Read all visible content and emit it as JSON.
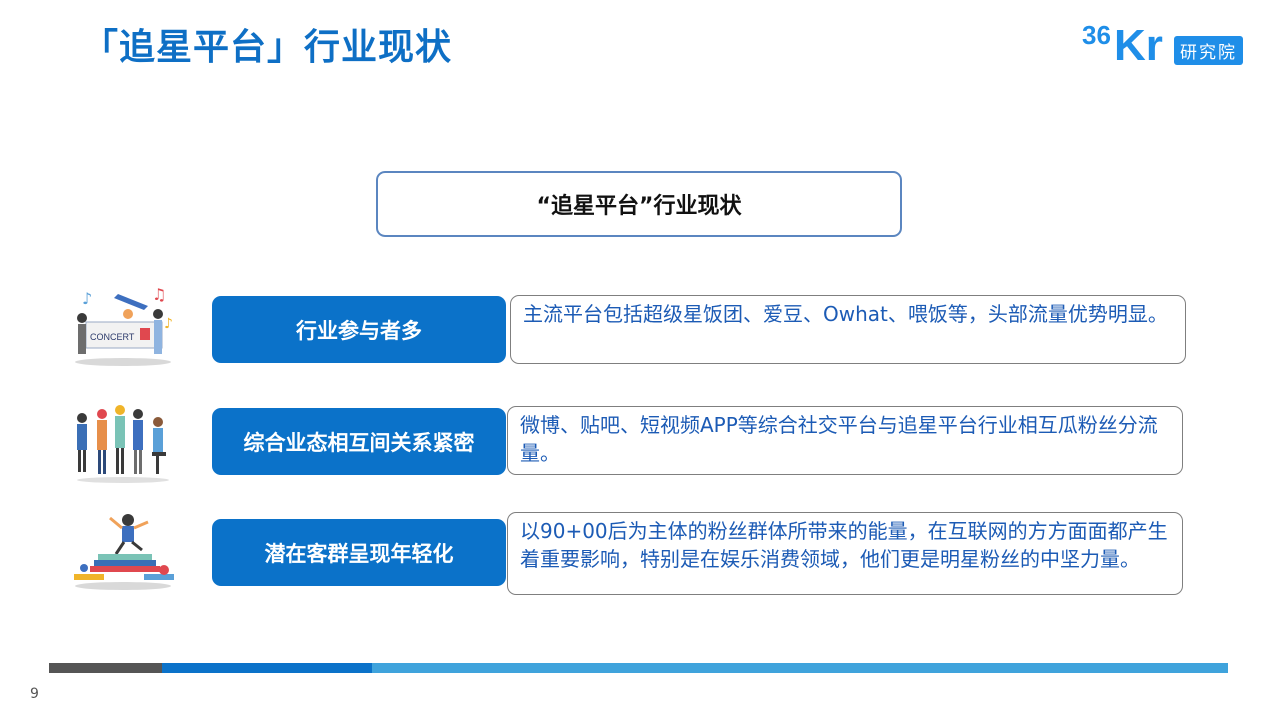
{
  "header": {
    "title": "「追星平台」行业现状",
    "logo_text": "36Kr",
    "logo_badge": "研究院"
  },
  "center_title": "“追星平台”行业现状",
  "rows": [
    {
      "label": "行业参与者多",
      "text": "主流平台包括超级星饭团、爱豆、Owhat、喂饭等，头部流量优势明显。",
      "illustration_icon": "concert-fans-icon",
      "illustration_text": "CONCERT"
    },
    {
      "label": "综合业态相互间关系紧密",
      "text": "微博、贴吧、短视频APP等综合社交平台与追星平台行业相互瓜粉丝分流量。",
      "illustration_icon": "group-people-icon"
    },
    {
      "label": "潜在客群呈现年轻化",
      "text": "以90+00后为主体的粉丝群体所带来的能量，在互联网的方方面面都产生着重要影响，特别是在娱乐消费领域，他们更是明星粉丝的中坚力量。",
      "illustration_icon": "youth-books-icon"
    }
  ],
  "footer": {
    "page_number": "9"
  },
  "colors": {
    "accent": "#0e6fc5",
    "label_bg": "#0b72c9",
    "desc_text": "#1c5bb5",
    "bar_dark": "#555555",
    "bar_mid": "#0b72c9",
    "bar_light": "#3fa3dc"
  }
}
